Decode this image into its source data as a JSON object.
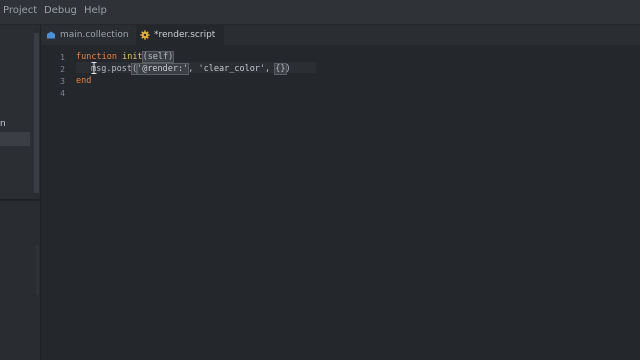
{
  "menu": {
    "items": [
      "Project",
      "Debug",
      "Help"
    ]
  },
  "left_panel": {
    "label": "n"
  },
  "tabs": [
    {
      "label": "main.collection",
      "close": "✕",
      "active": false
    },
    {
      "label": "*render.script",
      "close": "",
      "active": true
    }
  ],
  "editor": {
    "line_numbers": [
      "1",
      "2",
      "3",
      "4"
    ],
    "lines": {
      "l1_kw": "function",
      "l1_fn": "init",
      "l1_paren_open": "(",
      "l1_arg": "self",
      "l1_paren_close": ")",
      "l2_msg": "msg.post",
      "l2_open": "(",
      "l2_str1": "'@render:'",
      "l2_comma1": ", ",
      "l2_str2": "'clear_color'",
      "l2_comma2": ", ",
      "l2_brace": "{}",
      "l2_close": ")",
      "l3_kw": "end"
    }
  },
  "colors": {
    "keyword": "#e98340",
    "function_name": "#e8c45a",
    "background": "#24272b"
  },
  "icons": {
    "collection_tab": "collection-icon",
    "script_tab": "gear-icon"
  }
}
